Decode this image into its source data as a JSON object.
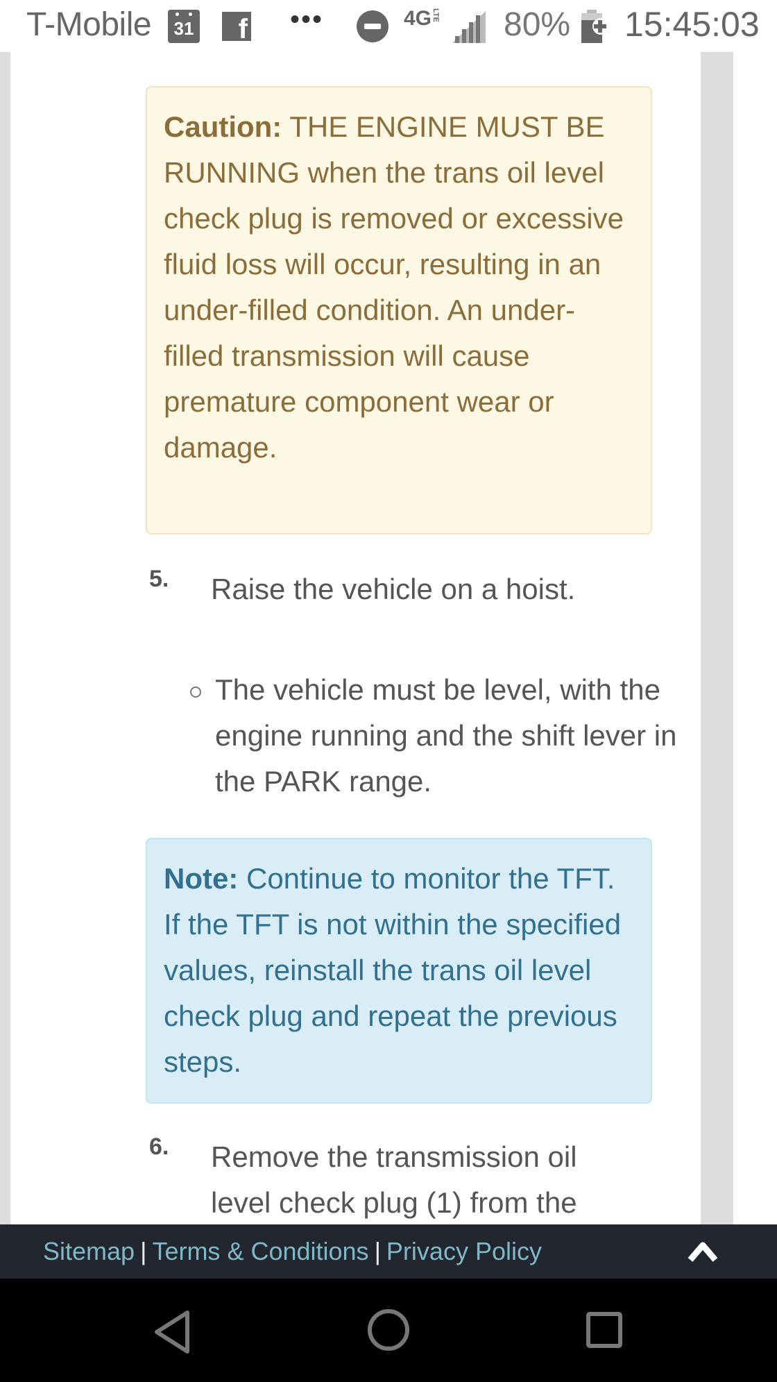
{
  "status_bar": {
    "carrier": "T-Mobile",
    "calendar_day": "31",
    "facebook_glyph": "f",
    "more_glyph": "•••",
    "network": "4G",
    "network_sub": "LTE",
    "battery_percent": "80%",
    "time": "15:45:03",
    "icons": [
      "calendar-icon",
      "facebook-icon",
      "more-notifications-icon",
      "do-not-disturb-icon",
      "4g-lte-icon",
      "signal-icon",
      "battery-charging-icon"
    ]
  },
  "content": {
    "caution": {
      "label": "Caution:",
      "text": " THE ENGINE MUST BE RUNNING when the trans oil level check plug is removed or excessive fluid loss will occur, resulting in an under-filled condition. An under-filled transmission will cause premature component wear or damage."
    },
    "steps": [
      {
        "number": "5.",
        "text": "Raise the vehicle on a hoist.",
        "sub_items": [
          "The vehicle must be level, with the engine running and the shift lever in the PARK range."
        ]
      },
      {
        "number": "6.",
        "text": "Remove the transmission oil level check plug (1) from the"
      }
    ],
    "note": {
      "label": "Note:",
      "text": " Continue to monitor the TFT. If the TFT is not within the specified values, reinstall the trans oil level check plug and repeat the previous steps."
    }
  },
  "footer": {
    "links": [
      "Sitemap",
      "Terms & Conditions",
      "Privacy Policy"
    ],
    "separator": "|",
    "back_to_top_icon": "chevron-up-icon"
  },
  "nav_bar": {
    "buttons": [
      "back",
      "home",
      "recent-apps"
    ]
  },
  "colors": {
    "caution_bg": "#fcf8e3",
    "caution_text": "#8a6d3b",
    "note_bg": "#d9edf7",
    "note_text": "#31708f",
    "footer_bg": "#22262e",
    "footer_link": "#7fb8c8"
  }
}
